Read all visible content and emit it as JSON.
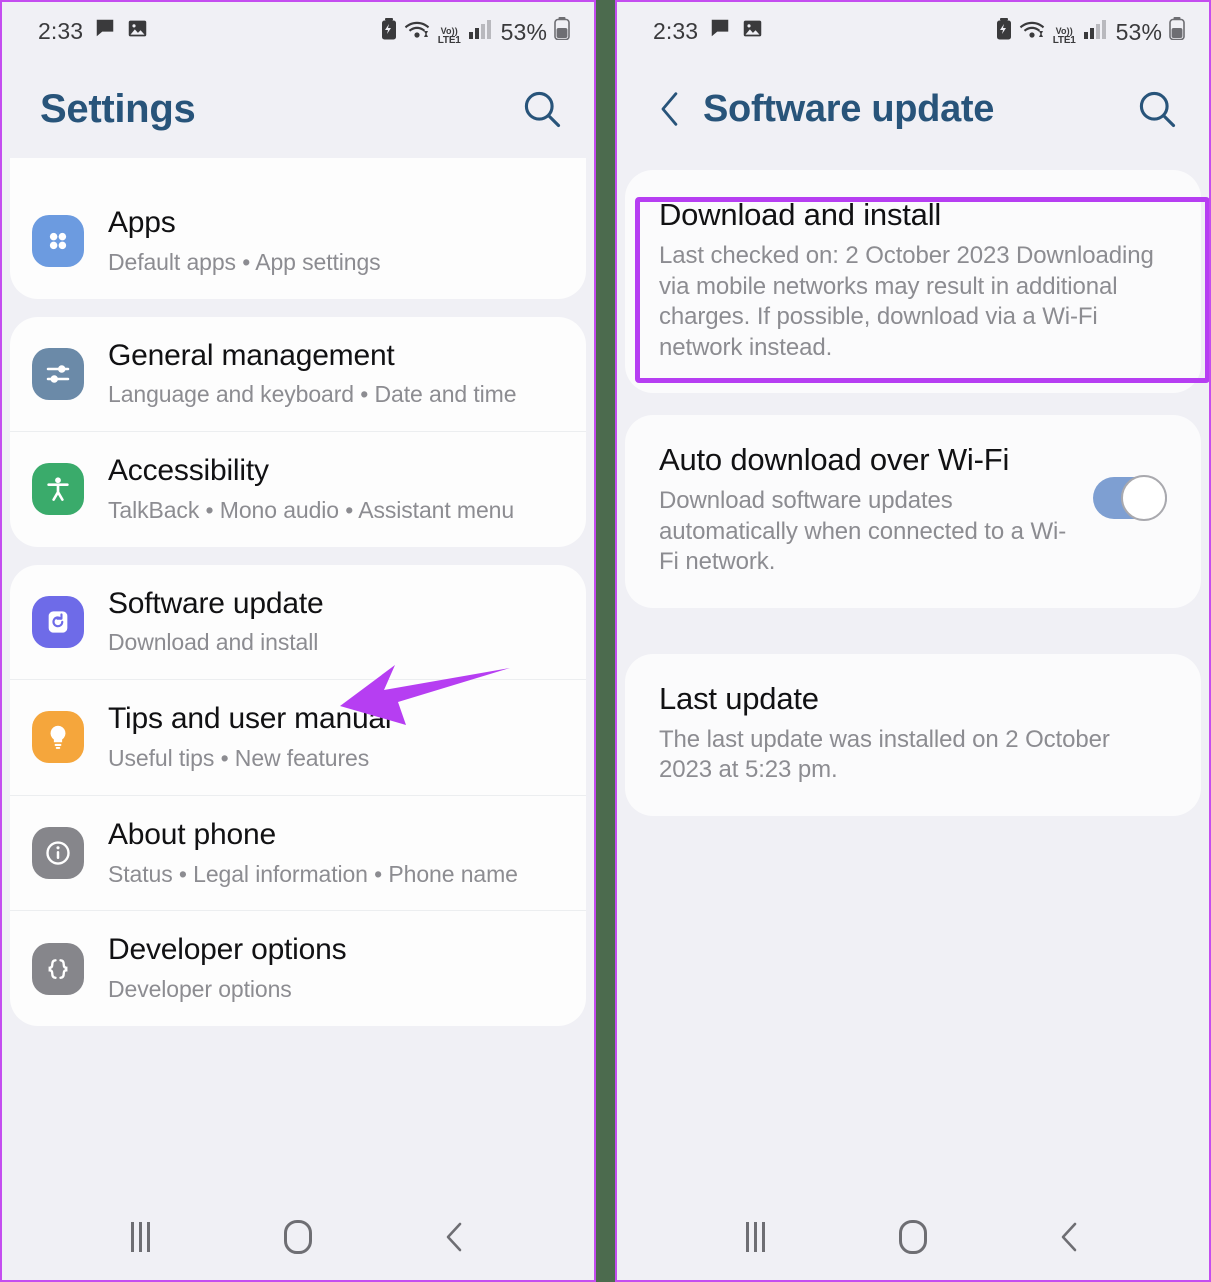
{
  "statusbar": {
    "time": "2:33",
    "battery_percent": "53%",
    "volte_top": "Vo))",
    "volte_bottom": "LTE1",
    "icons": [
      "chat-bubble-icon",
      "photo-icon",
      "battery-saver-icon",
      "wifi-icon",
      "volte-icon",
      "signal-bars-icon",
      "battery-icon"
    ]
  },
  "left_screen": {
    "title": "Settings",
    "search_label": "Search",
    "groups": [
      {
        "rows": [
          {
            "title": "Apps",
            "subtitle": "Default apps  •  App settings",
            "icon": "apps-grid-icon",
            "icon_color": "#6c9be0"
          }
        ]
      },
      {
        "rows": [
          {
            "title": "General management",
            "subtitle": "Language and keyboard  •  Date and time",
            "icon": "sliders-icon",
            "icon_color": "#6b8aa8"
          },
          {
            "title": "Accessibility",
            "subtitle": "TalkBack  •  Mono audio  •  Assistant menu",
            "icon": "accessibility-person-icon",
            "icon_color": "#3aab6b"
          }
        ]
      },
      {
        "rows": [
          {
            "title": "Software update",
            "subtitle": "Download and install",
            "icon": "software-update-refresh-icon",
            "icon_color": "#6e6be8"
          },
          {
            "title": "Tips and user manual",
            "subtitle": "Useful tips  •  New features",
            "icon": "lightbulb-icon",
            "icon_color": "#f5a63c"
          },
          {
            "title": "About phone",
            "subtitle": "Status  •  Legal information  •  Phone name",
            "icon": "info-circle-icon",
            "icon_color": "#86868b"
          },
          {
            "title": "Developer options",
            "subtitle": "Developer options",
            "icon": "code-braces-icon",
            "icon_color": "#86868b"
          }
        ]
      }
    ]
  },
  "right_screen": {
    "title": "Software update",
    "back_label": "Back",
    "search_label": "Search",
    "cards": [
      {
        "title": "Download and install",
        "subtitle": "Last checked on: 2 October 2023\nDownloading via mobile networks may result in additional charges. If possible, download via a Wi-Fi network instead.",
        "highlighted": true
      },
      {
        "title": "Auto download over Wi-Fi",
        "subtitle": "Download software updates automatically when connected to a Wi-Fi network.",
        "toggle": "on"
      },
      {
        "title": "Last update",
        "subtitle": "The last update was installed on 2 October 2023 at 5:23 pm."
      }
    ]
  },
  "navbar": {
    "recents_label": "Recents",
    "home_label": "Home",
    "back_label": "Back"
  },
  "annotations": {
    "arrow_color": "#b63ef2",
    "highlight_color": "#b63ef2",
    "arrow_target": "Software update",
    "divider_color": "#4c6b4e"
  }
}
